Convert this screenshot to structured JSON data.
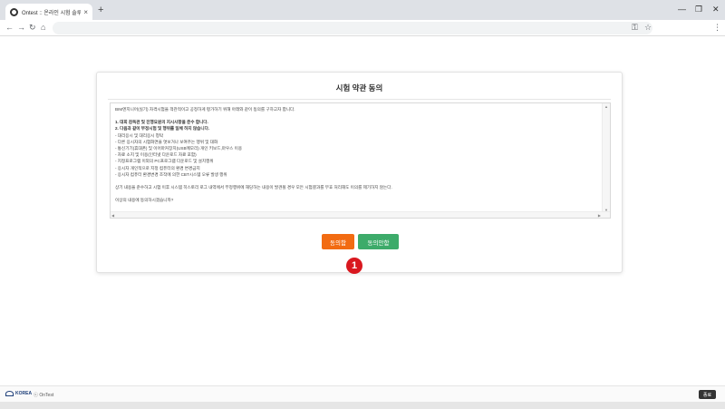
{
  "browser": {
    "tab_title": "Ontest :: 온라인 시험 솔루션",
    "tab_close": "×",
    "new_tab": "+",
    "minimize": "—",
    "restore": "❐",
    "close": "✕",
    "back": "←",
    "forward": "→",
    "reload": "↻",
    "home": "⌂",
    "key": "⚿",
    "star": "☆",
    "menu": "⋮",
    "url": ""
  },
  "card": {
    "title": "시험 약관 동의",
    "terms": {
      "intro": "BIM엔지니어(실기) 자격시험을 객관적이고 공정하게 평가하기 위해 아래와 같이 동의를 구하고자 합니다.",
      "rule1": "1. 대회 감독관 및 진행요원의 지시사항을 준수 합니다.",
      "rule2": "2. 다음과 같이 부정시험 및 행위를 일체 하지 않습니다.",
      "items": [
        "- 대리응시 및 대리응시 청탁",
        "- 다른 응시자의 시험화면을 엿보거나 보여주는 행위 및 대화",
        "- 통신기기(휴대폰) 및 이어마커장치(USB메모리) 개인 키보드,마우스 이용",
        "- 자료 소지 및 이용(인터넷 다운로드 자료 포함)",
        "- 지정프로그램 이외의 PC프로그램 다운로드 및 설치행위",
        "- 응시자 개인적으로 지정 컴퓨터의 환경 변경금지",
        "- 응시자 컴퓨터 환경변경 조작에 의한 CBT시스템 오류 발생 행위"
      ],
      "warning": "상기 내용을 준수하고 시험 이후 시스템 히스토리 로그 내역에서 부정행위에 해당하는 내용이 발견될 경우 모든 시험결과를 무효 처리해도 이의를 제기하지 않는다.",
      "question": "이상의 내용에 동의하시겠습니까?"
    },
    "agree_label": "동의함",
    "disagree_label": "동의안함"
  },
  "annotation": {
    "step": "1"
  },
  "footer": {
    "logo_text": "KOREA",
    "copyright": "ⓒ OnTest",
    "end_label": "종료"
  },
  "colors": {
    "agree": "#f26b12",
    "disagree": "#3dab6a",
    "step_badge": "#d9181f"
  }
}
